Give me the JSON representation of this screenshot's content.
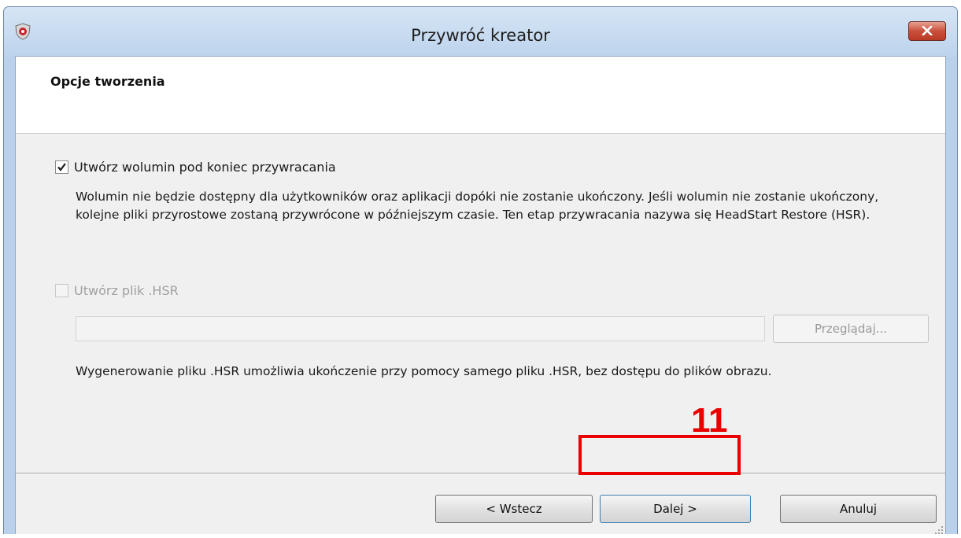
{
  "window": {
    "title": "Przywróć kreator"
  },
  "header": {
    "title": "Opcje tworzenia"
  },
  "options": {
    "create_volume": {
      "label": "Utwórz wolumin pod koniec przywracania",
      "checked": true,
      "description_line1": "Wolumin nie będzie dostępny dla użytkowników oraz aplikacji dopóki nie zostanie ukończony. Jeśli wolumin nie zostanie ukończony,",
      "description_line2": "kolejne pliki przyrostowe zostaną przywrócone w późniejszym czasie. Ten etap przywracania nazywa się HeadStart Restore (HSR)."
    },
    "create_hsr": {
      "label": "Utwórz plik .HSR",
      "checked": false,
      "enabled": false,
      "path_value": "",
      "browse_label": "Przeglądaj...",
      "description": "Wygenerowanie pliku .HSR umożliwia ukończenie przy pomocy samego pliku .HSR, bez dostępu do plików obrazu."
    }
  },
  "buttons": {
    "back_label": "< Wstecz",
    "next_label": "Dalej >",
    "cancel_label": "Anuluj"
  },
  "annotation": {
    "step_number": "11",
    "color": "#ea0000"
  },
  "icons": {
    "app": "restore-wizard-icon",
    "close": "close-icon",
    "checkmark": "checkmark-icon",
    "grip": "resize-grip-icon"
  }
}
